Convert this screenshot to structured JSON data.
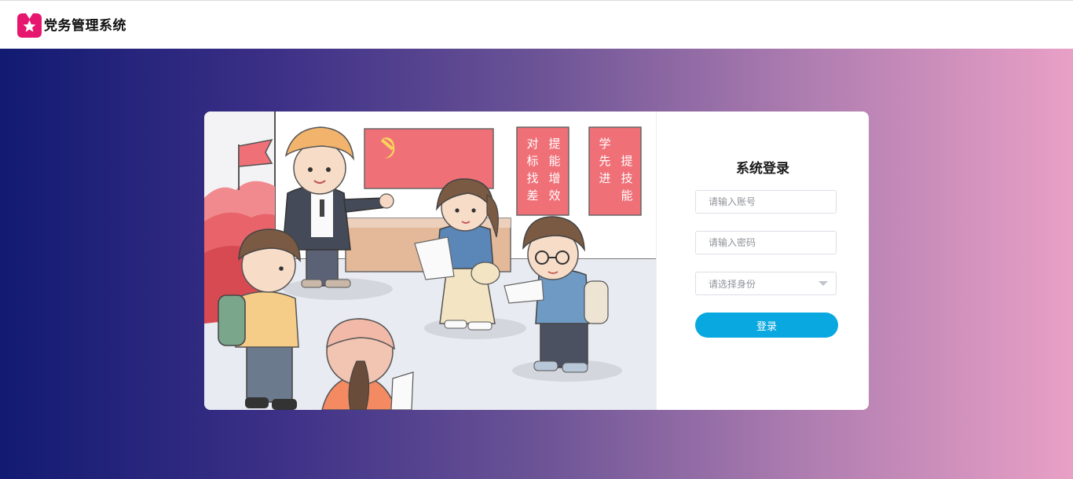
{
  "app": {
    "title": "党务管理系统",
    "logo_icon": "star-bookmark-icon",
    "brand_color": "#e6176f"
  },
  "illustration": {
    "banner_left": [
      "对",
      "标",
      "找",
      "差"
    ],
    "banner_right": [
      "提",
      "能",
      "增",
      "效"
    ],
    "banner2_left": [
      "学",
      "先",
      "进"
    ],
    "banner2_right": [
      "提",
      "技",
      "能"
    ],
    "flag_icon": "hammer-sickle-flag-icon"
  },
  "login": {
    "title": "系统登录",
    "account_placeholder": "请输入账号",
    "password_placeholder": "请输入密码",
    "identity_placeholder": "请选择身份",
    "submit_label": "登录",
    "button_color": "#0aa8e0"
  },
  "theme": {
    "gradient_start": "#121a72",
    "gradient_end": "#e9a0c6"
  }
}
